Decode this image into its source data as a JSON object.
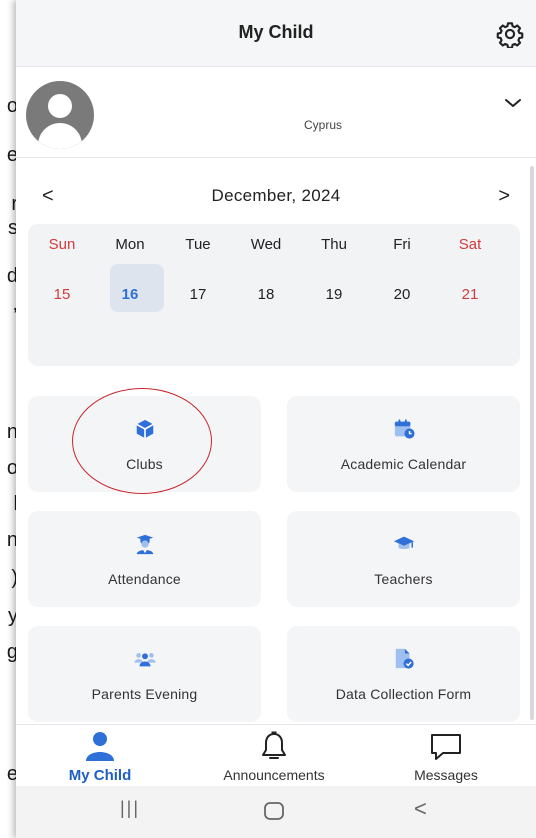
{
  "background_text": [
    "o",
    "e",
    "r",
    "s",
    "d",
    ",",
    "n",
    "o",
    "l",
    "n",
    ")",
    "y",
    "g",
    "e"
  ],
  "header": {
    "title": "My Child"
  },
  "profile": {
    "country": "Cyprus"
  },
  "calendar": {
    "month_label": "December, 2024",
    "prev": "<",
    "next": ">",
    "day_names": [
      "Sun",
      "Mon",
      "Tue",
      "Wed",
      "Thu",
      "Fri",
      "Sat"
    ],
    "dates": [
      "15",
      "16",
      "17",
      "18",
      "19",
      "20",
      "21"
    ],
    "selected_date": "16"
  },
  "tiles": {
    "clubs": "Clubs",
    "academic_calendar": "Academic Calendar",
    "attendance": "Attendance",
    "teachers": "Teachers",
    "parents_evening": "Parents Evening",
    "data_collection_form": "Data Collection Form"
  },
  "bottom_nav": {
    "my_child": "My Child",
    "announcements": "Announcements",
    "messages": "Messages"
  },
  "system_nav": {
    "recents": "|||",
    "back": "<"
  },
  "colors": {
    "accent": "#2e6fd8",
    "active_nav": "#1f5fc4",
    "weekend": "#d23b3b",
    "annotation": "#c8262c"
  }
}
